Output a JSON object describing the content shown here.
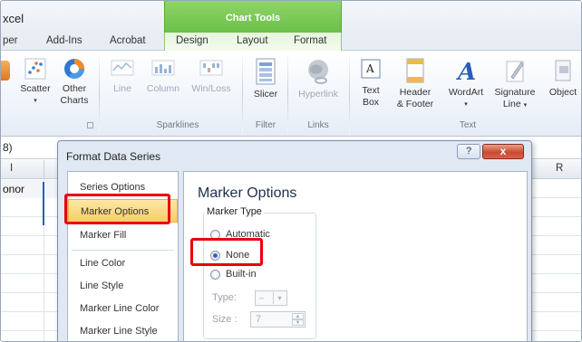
{
  "titlebar": {
    "app_title": "xcel",
    "context_label": "Chart Tools"
  },
  "tabs": [
    {
      "label": "per",
      "active": false
    },
    {
      "label": "Add-Ins",
      "active": false
    },
    {
      "label": "Acrobat",
      "active": false
    },
    {
      "label": "Design",
      "active": false
    },
    {
      "label": "Layout",
      "active": false
    },
    {
      "label": "Format",
      "active": false
    }
  ],
  "ribbon": {
    "charts_group": {
      "scatter": "Scatter",
      "other_charts_line1": "Other",
      "other_charts_line2": "Charts"
    },
    "sparklines_group": {
      "label": "Sparklines",
      "line": "Line",
      "column": "Column",
      "winloss": "Win/Loss"
    },
    "filter_group": {
      "label": "Filter",
      "slicer": "Slicer"
    },
    "links_group": {
      "label": "Links",
      "hyperlink": "Hyperlink"
    },
    "text_group": {
      "label": "Text",
      "textbox_line1": "Text",
      "textbox_line2": "Box",
      "header_line1": "Header",
      "header_line2": "& Footer",
      "wordart": "WordArt",
      "signature_line1": "Signature",
      "signature_line2": "Line",
      "object": "Object"
    }
  },
  "formula_bar": {
    "namebox": "8)"
  },
  "sheet": {
    "col_i": "I",
    "col_r": "R",
    "cell_text": "onor"
  },
  "dialog": {
    "title": "Format Data Series",
    "help_glyph": "?",
    "close_glyph": "x",
    "nav_items": [
      {
        "label": "Series Options",
        "selected": false
      },
      {
        "label": "Marker Options",
        "selected": true
      },
      {
        "label": "Marker Fill",
        "selected": false
      },
      {
        "label": "Line Color",
        "selected": false
      },
      {
        "label": "Line Style",
        "selected": false
      },
      {
        "label": "Marker Line Color",
        "selected": false
      },
      {
        "label": "Marker Line Style",
        "selected": false
      }
    ],
    "content": {
      "section_title": "Marker Options",
      "marker_type_label": "Marker Type",
      "radio_automatic": "Automatic",
      "radio_none": "None",
      "radio_builtin": "Built-in",
      "selected_radio": "None",
      "type_label": "Type:",
      "size_label": "Size :",
      "size_value": "7"
    }
  },
  "colors": {
    "chart_tools_green": "#6cc048",
    "highlight_red": "#e8000b",
    "selected_nav": "#f8cd64"
  }
}
